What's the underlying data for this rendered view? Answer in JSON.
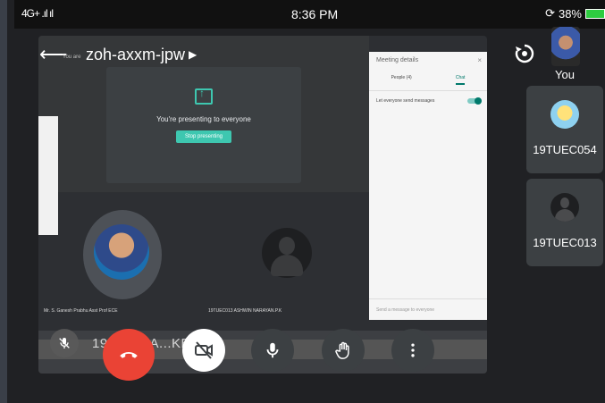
{
  "status_bar": {
    "signal": "4G+ .ıl ıl",
    "time": "8:36 PM",
    "battery": "38%"
  },
  "meeting": {
    "code": "zoh-axxm-jpw",
    "you_are_text": "You are",
    "presenting_text": "You're presenting to everyone",
    "stop_presenting": "Stop presenting"
  },
  "screen": {
    "participant_1_name": "Mr. S. Ganesh Prabhu Asst Prof ECE",
    "participant_2_name": "19TUEC013 ASHWIN NARAYAN.P.K",
    "overlay_text": "19...54 KA...KEYA"
  },
  "panel": {
    "title": "Meeting details",
    "close": "×",
    "tab_people": "People (4)",
    "tab_chat": "Chat",
    "toggle_label": "Let everyone send messages",
    "input_placeholder": "Send a message to everyone"
  },
  "participants": [
    {
      "name": "You"
    },
    {
      "name": "19TUEC054"
    },
    {
      "name": "19TUEC013"
    }
  ],
  "icons": {
    "back": "back-arrow-icon",
    "rotate": "rotate-camera-icon",
    "mic_off": "mic-off-icon",
    "end_call": "end-call-icon",
    "cam_off": "camera-off-icon",
    "mic": "mic-icon",
    "hand": "raise-hand-icon",
    "more": "more-vertical-icon"
  },
  "colors": {
    "end_call": "#ea4335",
    "accent": "#3ec7b0",
    "battery": "#2ecc40"
  }
}
